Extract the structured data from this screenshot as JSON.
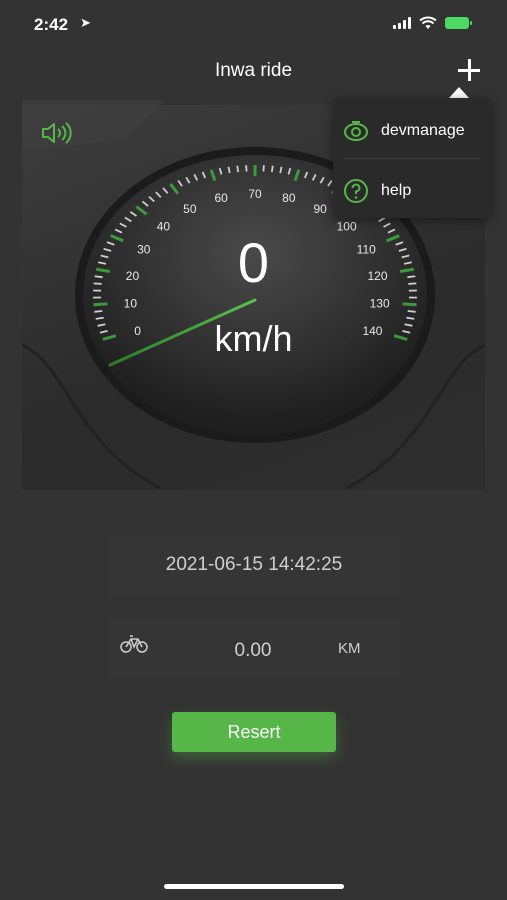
{
  "status_bar": {
    "time": "2:42",
    "location_glyph": "➤"
  },
  "header": {
    "title": "Inwa ride"
  },
  "menu": {
    "items": [
      {
        "label": "devmanage",
        "icon": "eye-target-icon"
      },
      {
        "label": "help",
        "icon": "question-circle-icon"
      }
    ]
  },
  "gauge": {
    "speed": "0",
    "unit": "km/h",
    "ticks": [
      "0",
      "10",
      "20",
      "30",
      "40",
      "50",
      "60",
      "70",
      "80",
      "90",
      "100",
      "110",
      "120",
      "130",
      "140"
    ],
    "min": 0,
    "max": 140,
    "needle_value": 0
  },
  "trip": {
    "datetime": "2021-06-15 14:42:25",
    "distance": "0.00",
    "distance_unit": "KM"
  },
  "actions": {
    "reset_label": "Resert"
  },
  "colors": {
    "accent": "#56b648",
    "background": "#333333",
    "tick_green": "#3c9a3a"
  }
}
